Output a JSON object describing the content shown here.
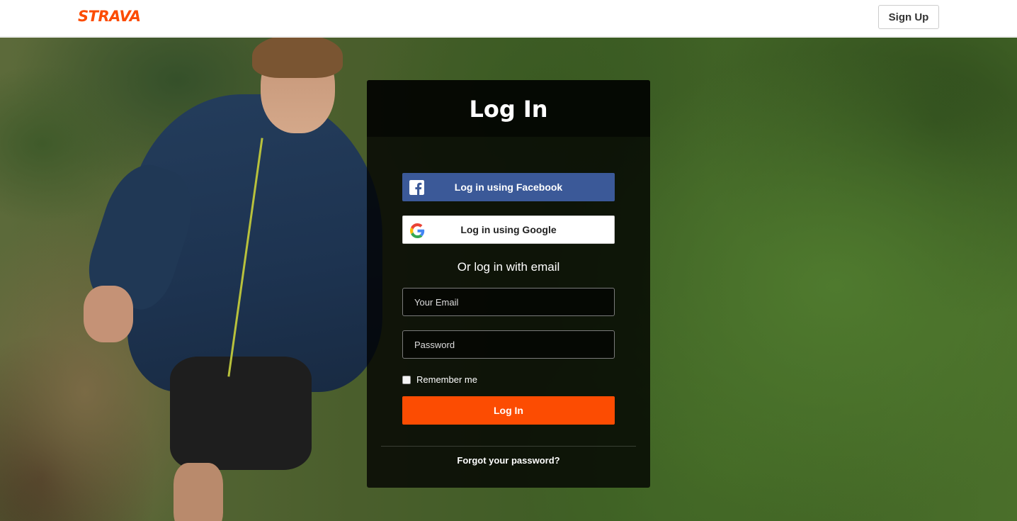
{
  "header": {
    "logo": "STRAVA",
    "signup_label": "Sign Up"
  },
  "login": {
    "title": "Log In",
    "facebook_label": "Log in using Facebook",
    "google_label": "Log in using Google",
    "or_text": "Or log in with email",
    "email_placeholder": "Your Email",
    "password_placeholder": "Password",
    "remember_label": "Remember me",
    "submit_label": "Log In",
    "forgot_label": "Forgot your password?"
  },
  "icons": {
    "facebook": "facebook-icon",
    "google": "google-icon"
  },
  "colors": {
    "brand": "#fc4c02",
    "facebook": "#3b5998"
  }
}
